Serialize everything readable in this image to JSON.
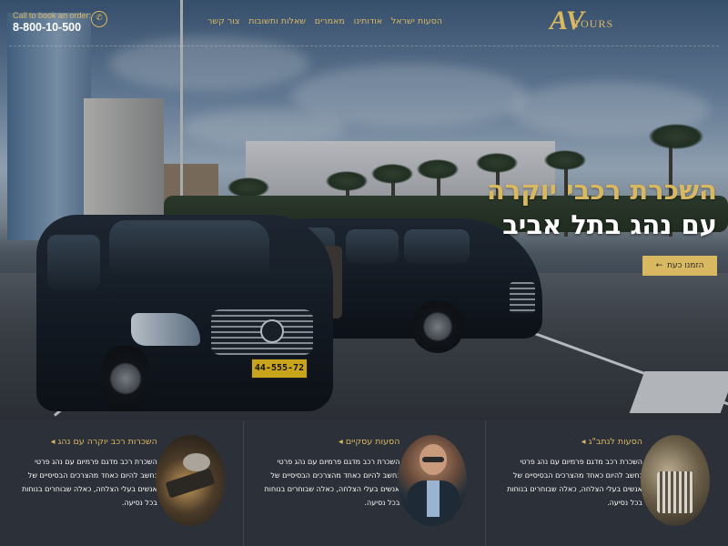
{
  "header": {
    "phone_label": "Call to book an order:",
    "phone_number": "8-800-10-500",
    "phone_icon": "phone-icon",
    "logo_letter": "AV",
    "logo_text": "TOURS"
  },
  "nav": {
    "items": [
      {
        "label": "הסעות ישראל"
      },
      {
        "label": "אודותינו"
      },
      {
        "label": "מאמרים"
      },
      {
        "label": "שאלות ותשובות"
      },
      {
        "label": "צור קשר"
      }
    ]
  },
  "hero": {
    "headline_1": "השכרת רכבי יוקרה",
    "headline_2": "עם נהג בתל אביב",
    "cta_label": "הזמנו כעת",
    "cta_icon": "arrow-left-icon",
    "plate_text": "44-555-72"
  },
  "services": [
    {
      "title": "הסעות לנתב\"ג",
      "arrow": "◂",
      "description": "השכרת רכב מדגם פרמיום עם נהג פרטי נחשב להיום כאחד מהצרכים הבסיסיים של אנשים בעלי הצלחה, כאלה שבוחרים בנוחות בכל נסיעה."
    },
    {
      "title": "הסעות עסקיים",
      "arrow": "◂",
      "description": "השכרת רכב מדגם פרמיום עם נהג פרטי נחשב להיום כאחד מהצרכים הבסיסיים של אנשים בעלי הצלחה, כאלה שבוחרים בנוחות בכל נסיעה."
    },
    {
      "title": "השכרות רכב יוקרה עם נהג",
      "arrow": "◂",
      "description": "השכרת רכב מדגם פרמיום עם נהג פרטי נחשב להיום כאחד מהצרכים הבסיסיים של אנשים בעלי הצלחה, כאלה שבוחרים בנוחות בכל נסיעה."
    }
  ],
  "colors": {
    "accent_gold": "#d9b862",
    "services_bg": "#2c3038"
  }
}
